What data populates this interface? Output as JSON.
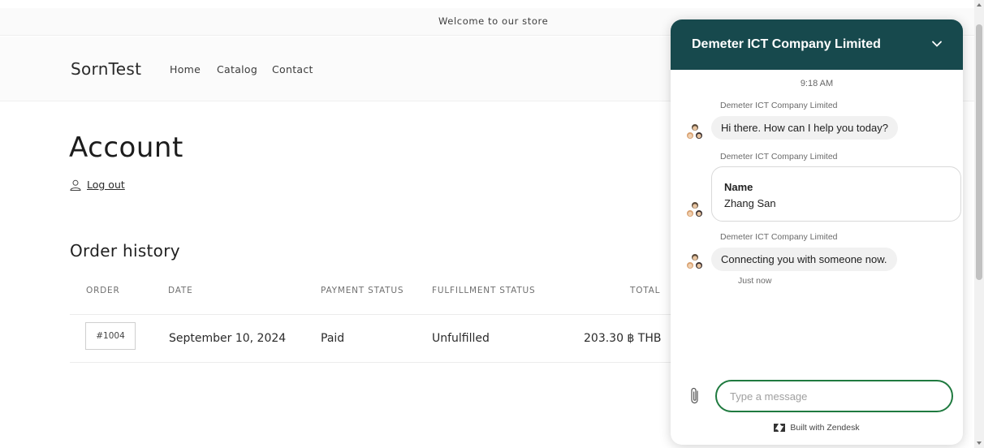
{
  "announcement": "Welcome to our store",
  "header": {
    "logo": "SornTest",
    "nav": [
      "Home",
      "Catalog",
      "Contact"
    ]
  },
  "account": {
    "title": "Account",
    "logout_label": "Log out",
    "order_history_title": "Order history"
  },
  "orders": {
    "columns": [
      "ORDER",
      "DATE",
      "PAYMENT STATUS",
      "FULFILLMENT STATUS",
      "TOTAL"
    ],
    "rows": [
      {
        "order": "#1004",
        "date": "September 10, 2024",
        "payment": "Paid",
        "fulfillment": "Unfulfilled",
        "total": "203.30 ฿ THB"
      }
    ]
  },
  "chat": {
    "company": "Demeter ICT Company Limited",
    "time": "9:18 AM",
    "messages": [
      {
        "sender": "Demeter ICT Company Limited",
        "text": "Hi there. How can I help you today?"
      },
      {
        "sender": "Demeter ICT Company Limited",
        "form_label": "Name",
        "form_value": "Zhang San"
      },
      {
        "sender": "Demeter ICT Company Limited",
        "text": "Connecting you with someone now."
      }
    ],
    "last_status": "Just now",
    "input_placeholder": "Type a message",
    "footer": "Built with Zendesk",
    "header_color": "#17494d",
    "input_border_color": "#1f7a3f"
  }
}
